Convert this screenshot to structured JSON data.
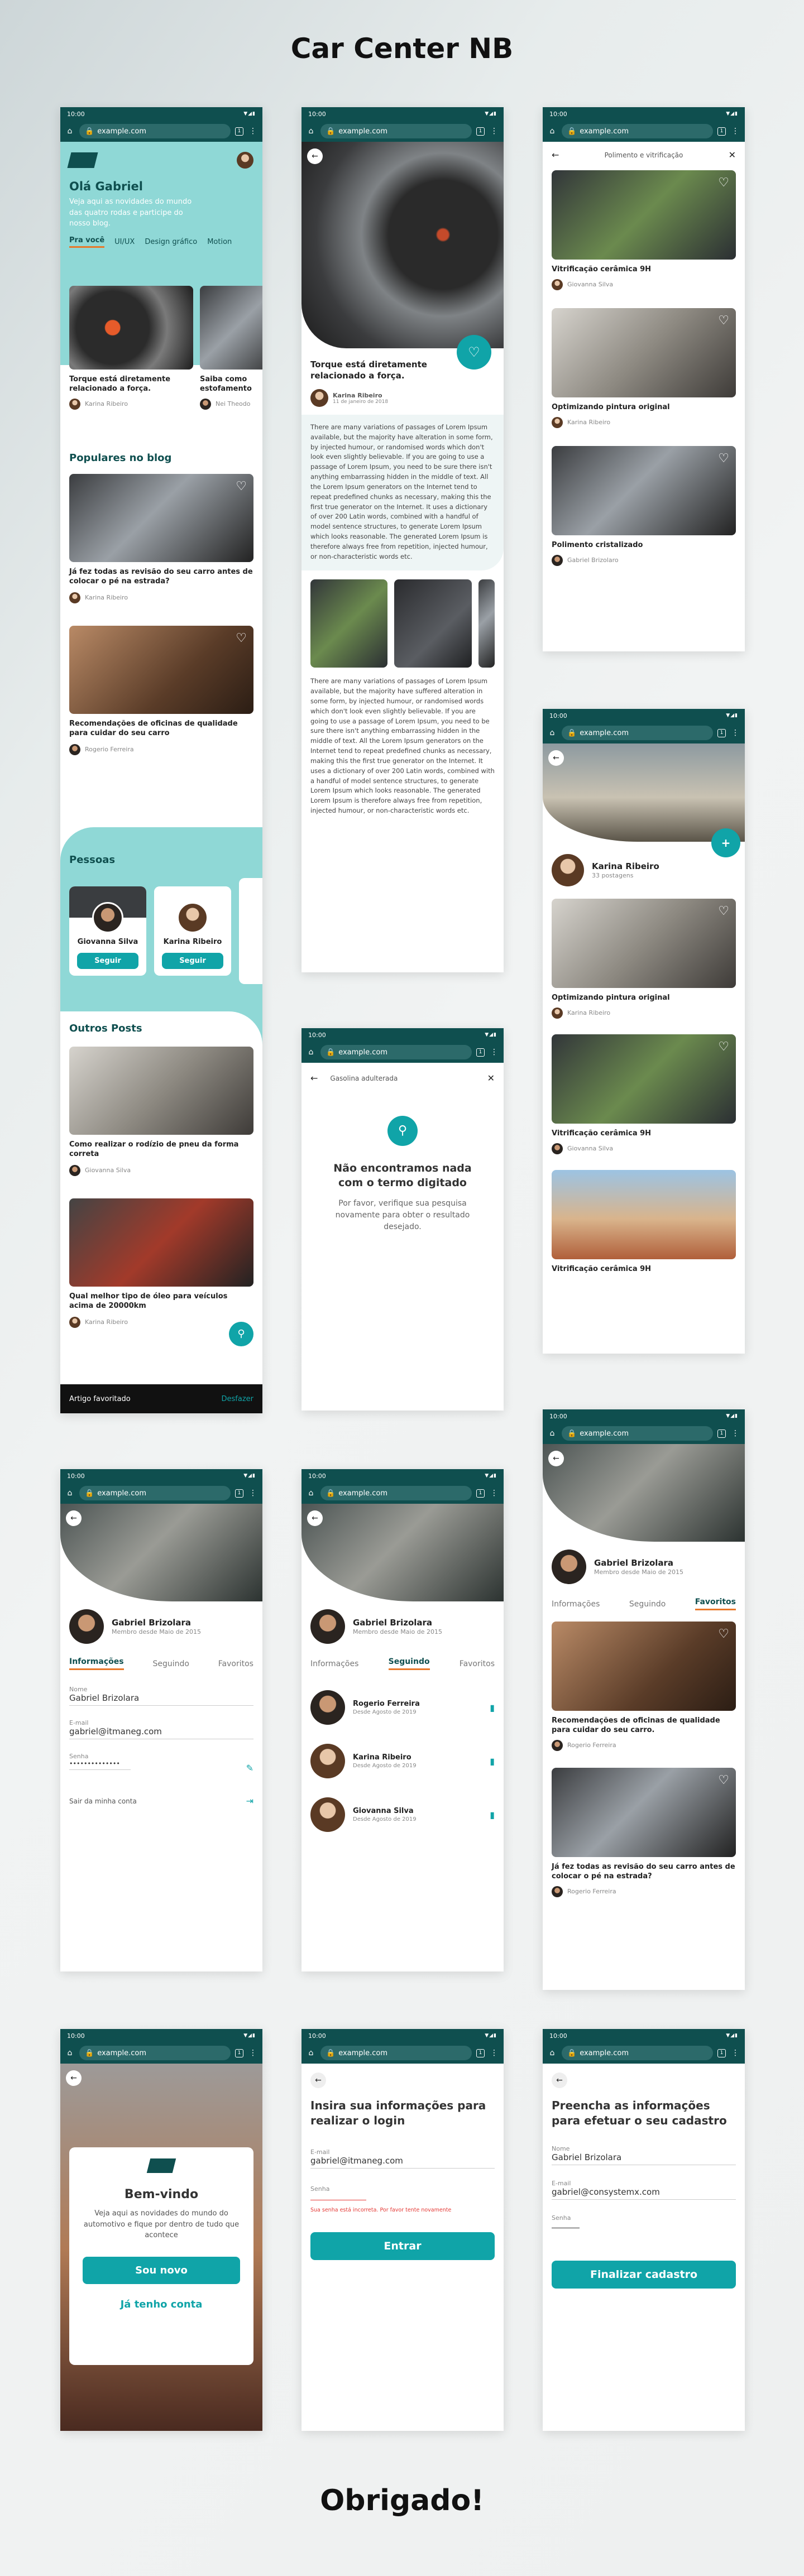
{
  "title": "Car Center NB",
  "footer": "Obrigado!",
  "browser": {
    "time": "10:00",
    "url": "example.com",
    "tabs": "1"
  },
  "home": {
    "greeting": "Olá Gabriel",
    "intro": "Veja aqui as novidades do mundo das quatro rodas e participe do nosso blog.",
    "tabs": [
      "Pra você",
      "UI/UX",
      "Design gráfico",
      "Motion"
    ],
    "cards": [
      {
        "title": "Torque está diretamente relacionado a força.",
        "author": "Karina Ribeiro"
      },
      {
        "title": "Saiba como estofamento",
        "author": "Nei Theodo"
      }
    ],
    "popular_title": "Populares no blog",
    "popular": [
      {
        "title": "Já fez todas as revisão do seu carro antes de colocar o pé na estrada?",
        "author": "Karina Ribeiro"
      },
      {
        "title": "Recomendações de oficinas de qualidade para cuidar do seu carro",
        "author": "Rogerio Ferreira"
      }
    ],
    "people_title": "Pessoas",
    "people": [
      {
        "name": "Giovanna Silva",
        "action": "Seguir"
      },
      {
        "name": "Karina Ribeiro",
        "action": "Seguir"
      }
    ],
    "others_title": "Outros Posts",
    "others": [
      {
        "title": "Como realizar o rodízio de pneu da forma correta",
        "author": "Giovanna Silva"
      },
      {
        "title": "Qual melhor tipo de óleo para veículos acima de 20000km",
        "author": "Karina Ribeiro"
      }
    ],
    "snackbar": "Artigo favoritado",
    "snackbar_action": "Desfazer"
  },
  "article": {
    "title": "Torque está diretamente relacionado a força.",
    "author": "Karina Ribeiro",
    "date": "11 de janeiro de 2018",
    "p1": "There are many variations of passages of Lorem Ipsum available, but the majority have alteration in some form, by injected humour, or randomised words which don't look even slightly believable. If you are going to use a passage of Lorem Ipsum, you need to be sure there isn't anything embarrassing hidden in the middle of text. All the Lorem Ipsum generators on the Internet tend to repeat predefined chunks as necessary, making this the first true generator on the Internet. It uses a dictionary of over 200 Latin words, combined with a handful of model sentence structures, to generate Lorem Ipsum which looks reasonable. The generated Lorem Ipsum is therefore always free from repetition, injected humour, or non-characteristic words etc.",
    "p2": "There are many variations of passages of Lorem Ipsum available, but the majority have suffered alteration in some form, by injected humour, or randomised words which don't look even slightly believable. If you are going to use a passage of Lorem Ipsum, you need to be sure there isn't anything embarrassing hidden in the middle of text. All the Lorem Ipsum generators on the Internet tend to repeat predefined chunks as necessary, making this the first true generator on the Internet. It uses a dictionary of over 200 Latin words, combined with a handful of model sentence structures, to generate Lorem Ipsum which looks reasonable. The generated Lorem Ipsum is therefore always free from repetition, injected humour, or non-characteristic words etc."
  },
  "search": {
    "query": "Polimento e vitrificação",
    "results": [
      {
        "title": "Vitrificação cerâmica 9H",
        "author": "Giovanna Silva"
      },
      {
        "title": "Optimizando pintura original",
        "author": "Karina Ribeiro"
      },
      {
        "title": "Polimento cristalizado",
        "author": "Gabriel Brizolaro"
      }
    ]
  },
  "profile_karina": {
    "name": "Karina Ribeiro",
    "posts": "33 postagens",
    "posts_list": [
      {
        "title": "Optimizando pintura original",
        "author": "Karina Ribeiro"
      },
      {
        "title": "Vitrificação cerâmica 9H",
        "author": "Giovanna Silva"
      },
      {
        "title": "Vitrificação cerâmica 9H"
      }
    ]
  },
  "no_results": {
    "query": "Gasolina  adulterada",
    "title": "Não encontramos nada com o termo digitado",
    "text": "Por favor, verifique sua pesquisa novamente para obter o resultado desejado."
  },
  "me": {
    "name": "Gabriel Brizolara",
    "since": "Membro desde Maio de 2015",
    "tabs": [
      "Informações",
      "Seguindo",
      "Favoritos"
    ],
    "name_label": "Nome",
    "name_value": "Gabriel Brizolara",
    "email_label": "E-mail",
    "email_value": "gabriel@itmaneg.com",
    "pass_label": "Senha",
    "pass_value": "••••••••••••••",
    "logout": "Sair da minha conta",
    "following": [
      {
        "name": "Rogerio Ferreira",
        "since": "Desde Agosto de 2019"
      },
      {
        "name": "Karina Ribeiro",
        "since": "Desde Agosto de 2019"
      },
      {
        "name": "Giovanna Silva",
        "since": "Desde Agosto de 2019"
      }
    ],
    "favorites": [
      {
        "title": "Recomendações de oficinas de qualidade para cuidar do seu carro.",
        "author": "Rogerio Ferreira"
      },
      {
        "title": "Já fez todas as revisão do seu carro antes de colocar o pé na estrada?",
        "author": "Rogerio Ferreira"
      }
    ]
  },
  "welcome": {
    "title": "Bem-vindo",
    "text": "Veja aqui as novidades do mundo do automotivo e fique por dentro de tudo que acontece",
    "primary": "Sou novo",
    "secondary": "Já tenho conta"
  },
  "login": {
    "title": "Insira sua informações para realizar o login",
    "email_label": "E-mail",
    "email_value": "gabriel@itmaneg.com",
    "pass_label": "Senha",
    "error": "Sua senha está incorreta. Por favor tente novamente",
    "button": "Entrar"
  },
  "signup": {
    "title": "Preencha as informações para efetuar o seu cadastro",
    "name_label": "Nome",
    "name_value": "Gabriel Brizolara",
    "email_label": "E-mail",
    "email_value": "gabriel@consystemx.com",
    "pass_label": "Senha",
    "button": "Finalizar cadastro"
  },
  "colors": {
    "teal_dark": "#0f4f4f",
    "accent": "#10a4a8",
    "orange": "#e8782a",
    "mint": "#8fd8d6"
  }
}
